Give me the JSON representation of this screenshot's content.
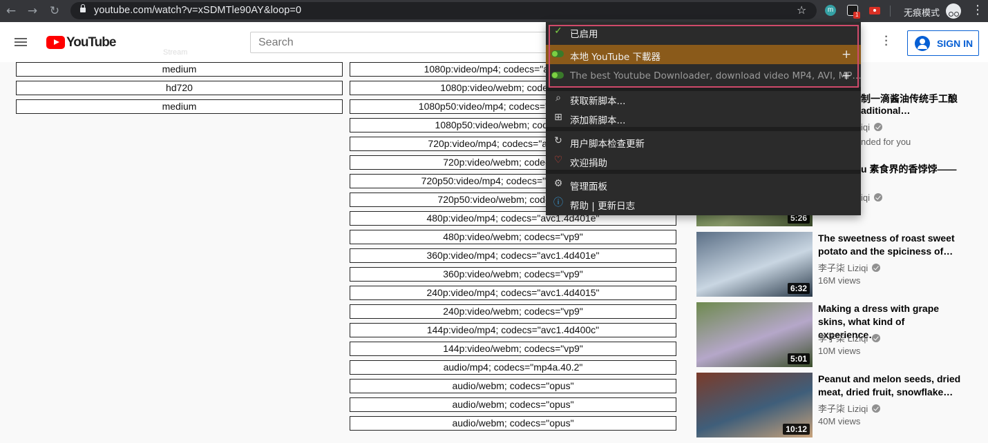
{
  "browser": {
    "url": "youtube.com/watch?v=xSDMTle90AY&loop=0",
    "incognito_label": "无痕模式",
    "ext_m_label": "m",
    "ext_badge": "1"
  },
  "header": {
    "logo_text": "YouTube",
    "search_placeholder": "Search",
    "signin_label": "SIGN IN",
    "faint_stream_label": "Stream"
  },
  "left_list": [
    "medium",
    "hd720",
    "medium"
  ],
  "mid_list": [
    "1080p:video/mp4; codecs=\"avc1.640028\"",
    "1080p:video/webm; codecs=\"vp9\"",
    "1080p50:video/mp4; codecs=\"avc1.64002a\"",
    "1080p50:video/webm; codecs=\"vp9\"",
    "720p:video/mp4; codecs=\"avc1.4d401f\"",
    "720p:video/webm; codecs=\"vp9\"",
    "720p50:video/mp4; codecs=\"avc1.4d4020\"",
    "720p50:video/webm; codecs=\"vp9\"",
    "480p:video/mp4; codecs=\"avc1.4d401e\"",
    "480p:video/webm; codecs=\"vp9\"",
    "360p:video/mp4; codecs=\"avc1.4d401e\"",
    "360p:video/webm; codecs=\"vp9\"",
    "240p:video/mp4; codecs=\"avc1.4d4015\"",
    "240p:video/webm; codecs=\"vp9\"",
    "144p:video/mp4; codecs=\"avc1.4d400c\"",
    "144p:video/webm; codecs=\"vp9\"",
    "audio/mp4; codecs=\"mp4a.40.2\"",
    "audio/webm; codecs=\"opus\"",
    "audio/webm; codecs=\"opus\"",
    "audio/webm; codecs=\"opus\""
  ],
  "partial_related": {
    "title1_line1": "制一滴酱油传统手工酿",
    "title1_line2": "aditional…",
    "channel1": "iqi",
    "views1": "nded for you",
    "title2": "u 素食界的香饽饽——",
    "channel2": "iqi",
    "duration2": "5:26"
  },
  "related": [
    {
      "title": "The sweetness of roast sweet potato and the spiciness of…",
      "channel": "李子柒 Liziqi",
      "views": "16M views",
      "duration": "6:32",
      "colors": [
        "#5b6f86",
        "#c9d6e2",
        "#2a3a4a"
      ]
    },
    {
      "title": "Making a dress with grape skins, what kind of experience…",
      "channel": "李子柒 Liziqi",
      "views": "10M views",
      "duration": "5:01",
      "colors": [
        "#6e8a4f",
        "#b5a7c9",
        "#3b4f2a"
      ]
    },
    {
      "title": "Peanut and melon seeds, dried meat, dried fruit, snowflake…",
      "channel": "李子柒 Liziqi",
      "views": "40M views",
      "duration": "10:12",
      "colors": [
        "#7a3b2a",
        "#3f5e7a",
        "#c9a27a"
      ]
    }
  ],
  "popup": {
    "enabled_label": "已启用",
    "script1": "本地 YouTube 下載器",
    "script2": "The best Youtube Downloader, download video MP4, AVI, MP…",
    "get_scripts": "获取新脚本...",
    "add_script": "添加新脚本...",
    "check_updates": "用户脚本检查更新",
    "donate": "欢迎捐助",
    "dashboard": "管理面板",
    "help": "帮助 | 更新日志"
  },
  "colors": {
    "yt_red": "#ff0000",
    "signin_blue": "#065fd4",
    "popup_bg": "#2b2b2b",
    "active_script_bg": "#8a5a1a",
    "highlight_border": "#d04a6a"
  }
}
